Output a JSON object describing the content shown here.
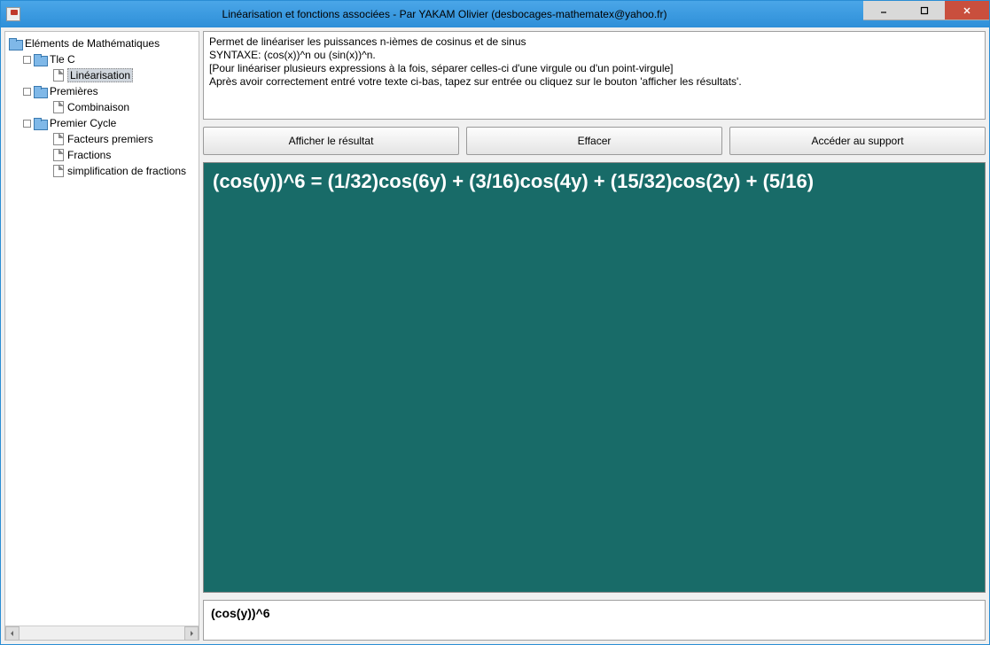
{
  "window": {
    "title": "Linéarisation et fonctions associées - Par YAKAM Olivier (desbocages-mathematex@yahoo.fr)"
  },
  "sidebar": {
    "root": "Eléments de Mathématiques",
    "groups": [
      {
        "label": "Tle C",
        "children": [
          {
            "label": "Linéarisation",
            "selected": true
          }
        ]
      },
      {
        "label": "Premières",
        "children": [
          {
            "label": "Combinaison"
          }
        ]
      },
      {
        "label": "Premier Cycle",
        "children": [
          {
            "label": "Facteurs premiers"
          },
          {
            "label": "Fractions"
          },
          {
            "label": "simplification de fractions"
          }
        ]
      }
    ]
  },
  "description": {
    "line1": "Permet de linéariser les puissances n-ièmes de cosinus et de sinus",
    "line2": "SYNTAXE: (cos(x))^n ou (sin(x))^n.",
    "line3": "[Pour linéariser plusieurs expressions à la fois, séparer celles-ci d'une virgule ou d'un point-virgule]",
    "line4": "Après avoir correctement entré votre texte ci-bas, tapez sur entrée ou cliquez sur le bouton 'afficher les résultats'."
  },
  "buttons": {
    "show": "Afficher le résultat",
    "clear": "Effacer",
    "support": "Accéder au support"
  },
  "result": "(cos(y))^6 = (1/32)cos(6y) + (3/16)cos(4y) + (15/32)cos(2y) + (5/16)",
  "input": {
    "value": "(cos(y))^6"
  }
}
